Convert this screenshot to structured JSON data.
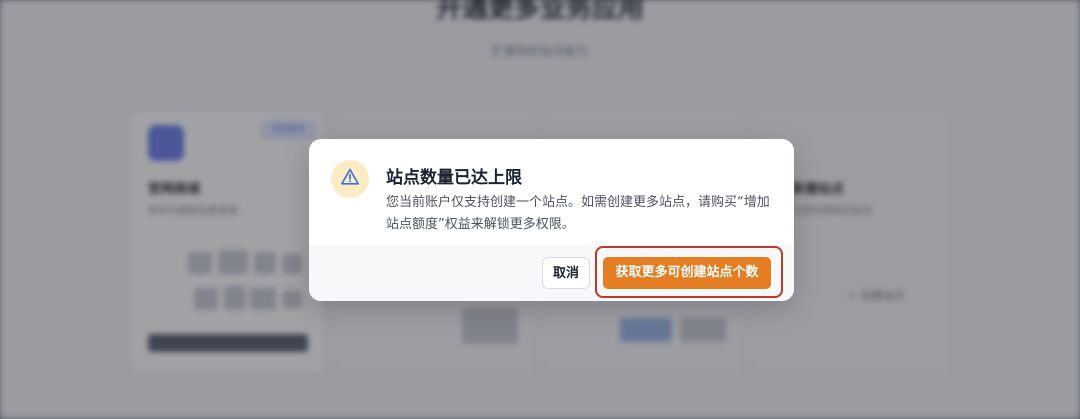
{
  "background": {
    "heading": "开通更多业务应用",
    "subheading": "扩展你的站点能力",
    "card_badge": "当前版本",
    "card_name": "官网商城",
    "card_desc": "多样化模板免费使用",
    "card_name_right": "新建站点",
    "card_desc_right": "立即创建新的站点",
    "link_text": "+ 创建站点"
  },
  "dialog": {
    "icon": "warning-icon",
    "title": "站点数量已达上限",
    "message": "您当前账户仅支持创建一个站点。如需创建更多站点，请购买“增加站点额度”权益来解锁更多权限。",
    "cancel_label": "取消",
    "confirm_label": "获取更多可创建站点个数"
  },
  "colors": {
    "primary": "#e57d22",
    "highlight_frame": "#c2372a",
    "warning_bg": "#fdebc4",
    "warning_icon": "#3b6fe0"
  }
}
